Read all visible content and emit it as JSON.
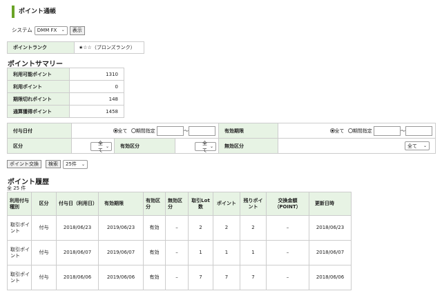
{
  "header": {
    "title": "ポイント通帳"
  },
  "system": {
    "label": "システム",
    "selected": "DMM FX",
    "show_button": "表示"
  },
  "rank": {
    "label": "ポイントランク",
    "value": "★☆☆（ブロンズランク）"
  },
  "summary": {
    "title": "ポイントサマリー",
    "rows": [
      {
        "label": "利用可能ポイント",
        "value": "1310"
      },
      {
        "label": "利用ポイント",
        "value": "0"
      },
      {
        "label": "期限切れポイント",
        "value": "148"
      },
      {
        "label": "通算獲得ポイント",
        "value": "1458"
      }
    ]
  },
  "filters": {
    "grant_date": {
      "label": "付与日付",
      "all": "全て",
      "range": "期間指定",
      "tilde": "〜"
    },
    "expiry": {
      "label": "有効期限",
      "all": "全て",
      "range": "期間指定",
      "tilde": "〜"
    },
    "category": {
      "label": "区分",
      "selected": "全て"
    },
    "valid_category": {
      "label": "有効区分",
      "selected": "全て"
    },
    "invalid_category": {
      "label": "無効区分",
      "selected": "全て"
    }
  },
  "actions": {
    "exchange_button": "ポイント交換",
    "search_label": "検索",
    "per_page": "25件"
  },
  "history": {
    "title": "ポイント履歴",
    "count": "全 25 件",
    "headers": [
      "利用付与種別",
      "区分",
      "付与日（利用日）",
      "有効期限",
      "有効区分",
      "無効区分",
      "取引Lot数",
      "ポイント",
      "残りポイント",
      "交換金額（POINT）",
      "更新日時"
    ],
    "rows": [
      [
        "取引ポイント",
        "付与",
        "2018/06/23",
        "2019/06/23",
        "有効",
        "–",
        "2",
        "2",
        "2",
        "–",
        "2018/06/23"
      ],
      [
        "取引ポイント",
        "付与",
        "2018/06/07",
        "2019/06/07",
        "有効",
        "–",
        "1",
        "1",
        "1",
        "–",
        "2018/06/07"
      ],
      [
        "取引ポイント",
        "付与",
        "2018/06/06",
        "2019/06/06",
        "有効",
        "–",
        "7",
        "7",
        "7",
        "–",
        "2018/06/06"
      ]
    ]
  },
  "colors": {
    "accent": "#6aa427",
    "label_bg": "#e7f3e4",
    "border": "#cccccc"
  }
}
